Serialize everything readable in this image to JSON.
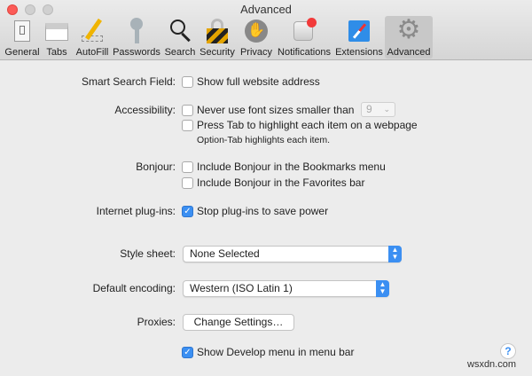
{
  "window": {
    "title": "Advanced"
  },
  "toolbar": [
    {
      "label": "General",
      "icon": "general-switch-icon"
    },
    {
      "label": "Tabs",
      "icon": "tabs-icon"
    },
    {
      "label": "AutoFill",
      "icon": "pencil-icon"
    },
    {
      "label": "Passwords",
      "icon": "key-icon"
    },
    {
      "label": "Search",
      "icon": "magnifier-icon"
    },
    {
      "label": "Security",
      "icon": "lock-icon"
    },
    {
      "label": "Privacy",
      "icon": "hand-icon"
    },
    {
      "label": "Notifications",
      "icon": "notification-icon"
    },
    {
      "label": "Extensions",
      "icon": "puzzle-compass-icon"
    },
    {
      "label": "Advanced",
      "icon": "gear-icon",
      "selected": true
    }
  ],
  "settings": {
    "smart_search": {
      "label": "Smart Search Field:",
      "option": "Show full website address",
      "checked": false
    },
    "accessibility": {
      "label": "Accessibility:",
      "min_font": "Never use font sizes smaller than",
      "min_font_value": "9",
      "press_tab": "Press Tab to highlight each item on a webpage",
      "note": "Option-Tab highlights each item."
    },
    "bonjour": {
      "label": "Bonjour:",
      "bookmarks": "Include Bonjour in the Bookmarks menu",
      "favorites": "Include Bonjour in the Favorites bar"
    },
    "plugins": {
      "label": "Internet plug-ins:",
      "option": "Stop plug-ins to save power",
      "checked": true
    },
    "style_sheet": {
      "label": "Style sheet:",
      "value": "None Selected"
    },
    "encoding": {
      "label": "Default encoding:",
      "value": "Western (ISO Latin 1)"
    },
    "proxies": {
      "label": "Proxies:",
      "button": "Change Settings…"
    },
    "develop": {
      "option": "Show Develop menu in menu bar",
      "checked": true
    }
  },
  "help": "?",
  "watermark": "wsxdn.com"
}
